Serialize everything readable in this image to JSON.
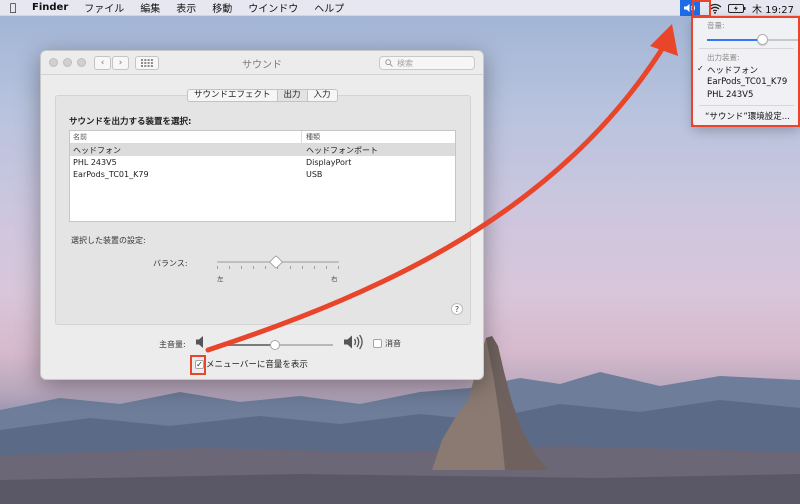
{
  "menubar": {
    "apple_icon": "apple-logo-icon",
    "app_name": "Finder",
    "items": [
      "ファイル",
      "編集",
      "表示",
      "移動",
      "ウインドウ",
      "ヘルプ"
    ],
    "clock": "木 19:27"
  },
  "window": {
    "title": "サウンド",
    "search_placeholder": "検索",
    "nav_back": "‹",
    "nav_forward": "›",
    "grid_icon": "grid-icon",
    "tabs": [
      "サウンドエフェクト",
      "出力",
      "入力"
    ],
    "active_tab": "出力",
    "output_heading": "サウンドを出力する装置を選択:",
    "table": {
      "columns": [
        "名前",
        "種類"
      ],
      "rows": [
        {
          "name": "ヘッドフォン",
          "type": "ヘッドフォンポート"
        },
        {
          "name": "PHL 243V5",
          "type": "DisplayPort"
        },
        {
          "name": "EarPods_TC01_K79",
          "type": "USB"
        }
      ]
    },
    "device_settings_label": "選択した装置の設定:",
    "balance_label": "バランス:",
    "balance_left": "左",
    "balance_right": "右",
    "balance_value": 0.5,
    "help_label": "?",
    "master_volume_label": "主音量:",
    "master_volume_value": 0.5,
    "mute_label": "消音",
    "mute_checked": false,
    "show_in_menubar_label": "メニューバーに音量を表示",
    "show_in_menubar_checked": true,
    "checkmark": "✓"
  },
  "volume_menu": {
    "volume_header": "音量:",
    "volume_value": 0.6,
    "output_header": "出力装置:",
    "checkmark": "✓",
    "devices": [
      "ヘッドフォン",
      "EarPods_TC01_K79",
      "PHL 243V5"
    ],
    "selected_device": "ヘッドフォン",
    "prefs_item": "“サウンド”環境設定..."
  },
  "colors": {
    "annotation": "#e8452b",
    "accent": "#1e6be8",
    "slider_blue": "#3478f6"
  }
}
